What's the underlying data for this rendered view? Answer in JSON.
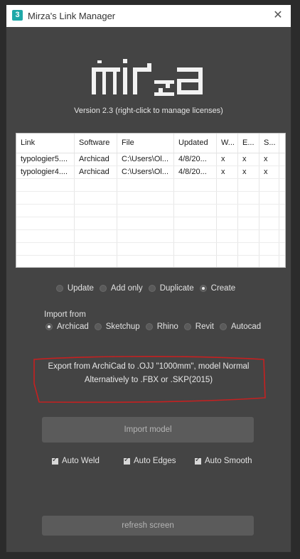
{
  "window": {
    "title": "Mirza's Link Manager",
    "app_icon_glyph": "3",
    "close_glyph": "✕"
  },
  "logo": {
    "text": "mirza"
  },
  "version": "Version 2.3 (right-click to manage licenses)",
  "table": {
    "headers": [
      "Link",
      "Software",
      "File",
      "Updated",
      "W...",
      "E...",
      "S..."
    ],
    "rows": [
      [
        "typologier5....",
        "Archicad",
        "C:\\Users\\Ol...",
        "4/8/20...",
        "x",
        "x",
        "x"
      ],
      [
        "typologier4....",
        "Archicad",
        "C:\\Users\\Ol...",
        "4/8/20...",
        "x",
        "x",
        "x"
      ]
    ]
  },
  "mode": {
    "options": [
      "Update",
      "Add only",
      "Duplicate",
      "Create"
    ],
    "selected": "Create"
  },
  "import_from": {
    "label": "Import from",
    "options": [
      "Archicad",
      "Sketchup",
      "Rhino",
      "Revit",
      "Autocad"
    ],
    "selected": "Archicad"
  },
  "info": {
    "line1": "Export from ArchiCad to .OJJ \"1000mm\", model Normal",
    "line2": "Alternatively to .FBX or .SKP(2015)"
  },
  "import_button": "Import model",
  "options": {
    "auto_weld": "Auto Weld",
    "auto_edges": "Auto Edges",
    "auto_smooth": "Auto Smooth"
  },
  "refresh_button": "refresh screen",
  "colors": {
    "annotation_red": "#c62020",
    "window_bg": "#444444",
    "button_bg": "#5b5b5b"
  }
}
